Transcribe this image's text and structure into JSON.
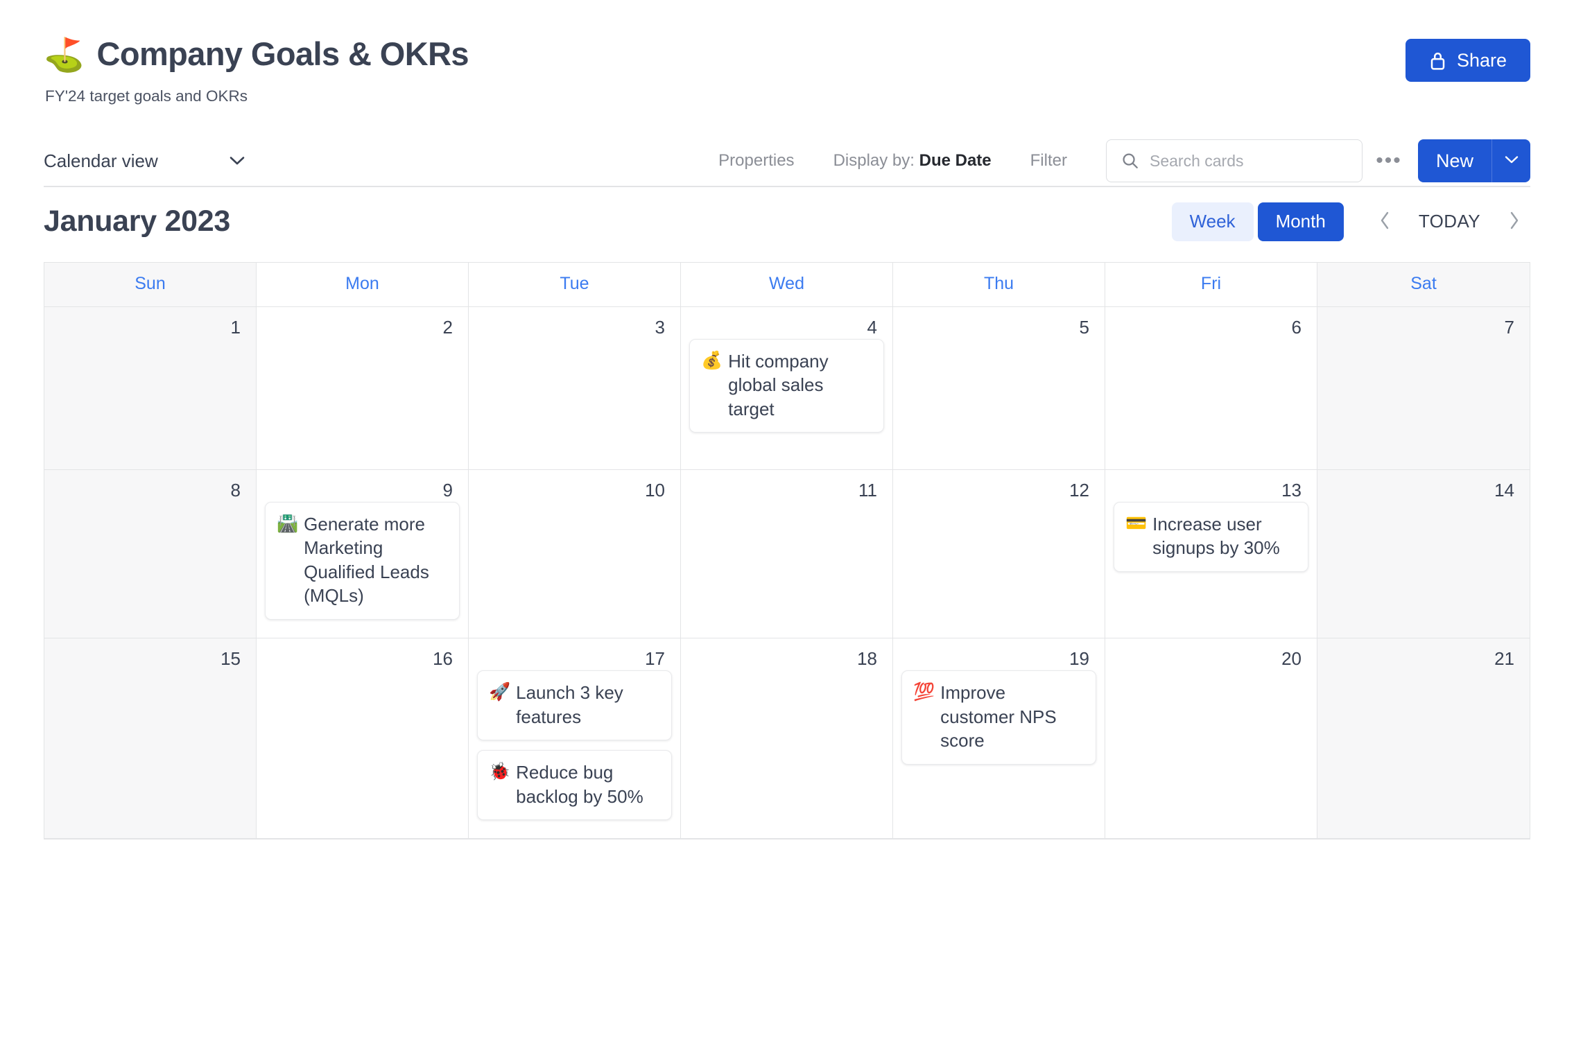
{
  "header": {
    "emoji": "⛳",
    "emoji_name": "golf-flag-emoji",
    "title": "Company Goals & OKRs",
    "subtitle": "FY'24 target goals and OKRs",
    "share_label": "Share"
  },
  "toolbar": {
    "view_label": "Calendar view",
    "properties_label": "Properties",
    "display_by_prefix": "Display by:",
    "display_by_value": "Due Date",
    "filter_label": "Filter",
    "search_placeholder": "Search cards",
    "search_value": "",
    "overflow_label": "•••",
    "new_label": "New"
  },
  "calendar_header": {
    "month_title": "January 2023",
    "week_label": "Week",
    "month_label": "Month",
    "today_label": "TODAY",
    "active_range": "Month"
  },
  "colors": {
    "accent": "#1f57d4",
    "accent_soft_bg": "#eaf0fd",
    "weekday_text": "#3b7bf0",
    "weekend_bg": "#f7f7f8",
    "border": "#e3e4e6",
    "text": "#3a4253",
    "muted_text": "#8b8e96"
  },
  "weekdays": [
    {
      "label": "Sun",
      "weekend": true
    },
    {
      "label": "Mon",
      "weekend": false
    },
    {
      "label": "Tue",
      "weekend": false
    },
    {
      "label": "Wed",
      "weekend": false
    },
    {
      "label": "Thu",
      "weekend": false
    },
    {
      "label": "Fri",
      "weekend": false
    },
    {
      "label": "Sat",
      "weekend": true
    }
  ],
  "weeks": [
    [
      {
        "day": "1",
        "weekend": true,
        "events": []
      },
      {
        "day": "2",
        "weekend": false,
        "events": []
      },
      {
        "day": "3",
        "weekend": false,
        "events": []
      },
      {
        "day": "4",
        "weekend": false,
        "events": [
          {
            "emoji": "💰",
            "emoji_name": "money-bag-emoji",
            "title": "Hit company global sales target"
          }
        ]
      },
      {
        "day": "5",
        "weekend": false,
        "events": []
      },
      {
        "day": "6",
        "weekend": false,
        "events": []
      },
      {
        "day": "7",
        "weekend": true,
        "events": []
      }
    ],
    [
      {
        "day": "8",
        "weekend": true,
        "events": []
      },
      {
        "day": "9",
        "weekend": false,
        "events": [
          {
            "emoji": "🛣️",
            "emoji_name": "motorway-emoji",
            "title": "Generate more Marketing Qualified Leads (MQLs)"
          }
        ]
      },
      {
        "day": "10",
        "weekend": false,
        "events": []
      },
      {
        "day": "11",
        "weekend": false,
        "events": []
      },
      {
        "day": "12",
        "weekend": false,
        "events": []
      },
      {
        "day": "13",
        "weekend": false,
        "events": [
          {
            "emoji": "💳",
            "emoji_name": "credit-card-emoji",
            "title": "Increase user signups by 30%"
          }
        ]
      },
      {
        "day": "14",
        "weekend": true,
        "events": []
      }
    ],
    [
      {
        "day": "15",
        "weekend": true,
        "events": []
      },
      {
        "day": "16",
        "weekend": false,
        "events": []
      },
      {
        "day": "17",
        "weekend": false,
        "events": [
          {
            "emoji": "🚀",
            "emoji_name": "rocket-emoji",
            "title": "Launch 3 key features"
          },
          {
            "emoji": "🐞",
            "emoji_name": "lady-beetle-emoji",
            "title": "Reduce bug backlog by 50%"
          }
        ]
      },
      {
        "day": "18",
        "weekend": false,
        "events": []
      },
      {
        "day": "19",
        "weekend": false,
        "events": [
          {
            "emoji": "💯",
            "emoji_name": "hundred-points-emoji",
            "title": "Improve customer NPS score"
          }
        ]
      },
      {
        "day": "20",
        "weekend": false,
        "events": []
      },
      {
        "day": "21",
        "weekend": true,
        "events": []
      }
    ]
  ]
}
